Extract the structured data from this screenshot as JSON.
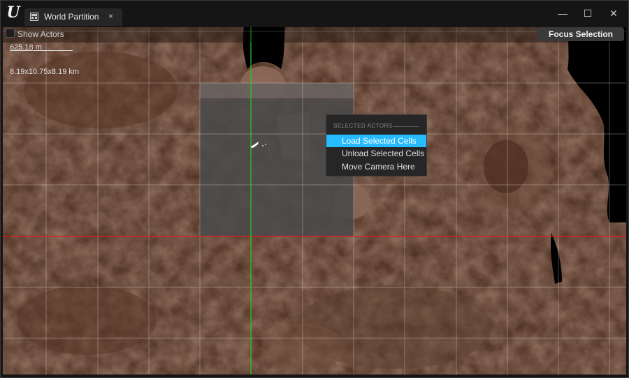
{
  "window": {
    "tab_label": "World Partition",
    "tab_close": "×",
    "minimize": "—",
    "maximize": "☐",
    "close": "✕"
  },
  "toolbar": {
    "show_actors_label": "Show Actors",
    "show_actors_checked": false,
    "focus_selection_label": "Focus Selection"
  },
  "overlay": {
    "scale_text": "625.18 m",
    "dimensions_text": "8.19x10.75x8.19 km"
  },
  "context_menu": {
    "section_header": "SELECTED ACTORS",
    "items": [
      {
        "label": "Load Selected Cells",
        "highlighted": true
      },
      {
        "label": "Unload Selected Cells",
        "highlighted": false
      },
      {
        "label": "Move Camera Here",
        "highlighted": false
      }
    ]
  },
  "icons": {
    "app_logo": "unreal-engine-logo-icon",
    "tab_icon": "world-partition-icon",
    "actor_marker": "player-start-icon"
  },
  "colors": {
    "accent": "#26bbff",
    "x_axis": "#d81e1e",
    "y_axis": "#1ed21e",
    "terrain": "#5c3a2a",
    "selection": "#4a4a4a"
  }
}
